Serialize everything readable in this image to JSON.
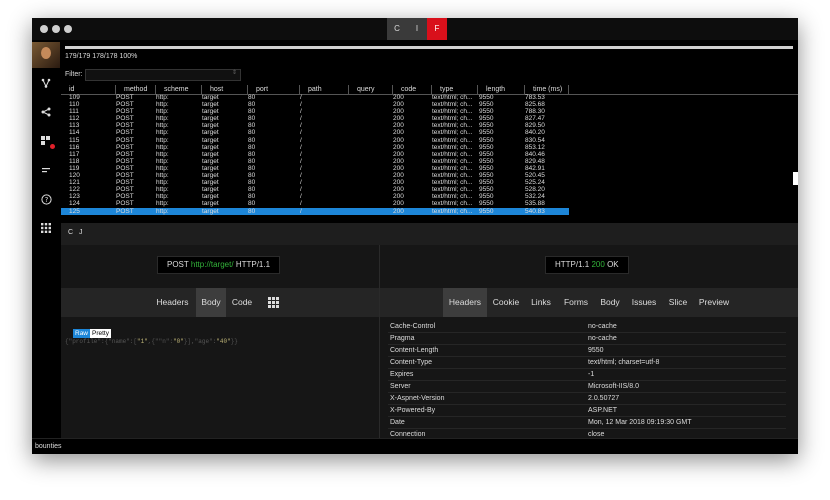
{
  "titlebar": {
    "modes": [
      "C",
      "I",
      "F"
    ],
    "active_mode": "F"
  },
  "progress": {
    "text": "179/179 178/178 100%",
    "fraction": 1.0
  },
  "filter": {
    "label": "Filter:",
    "value": ""
  },
  "table": {
    "columns": [
      "id",
      "method",
      "scheme",
      "host",
      "port",
      "path",
      "query",
      "code",
      "type",
      "length",
      "time (ms)"
    ],
    "rows": [
      [
        "109",
        "POST",
        "http:",
        "target",
        "80",
        "/",
        "",
        "200",
        "text/html; ch...",
        "9550",
        "783.53"
      ],
      [
        "110",
        "POST",
        "http:",
        "target",
        "80",
        "/",
        "",
        "200",
        "text/html; ch...",
        "9550",
        "825.68"
      ],
      [
        "111",
        "POST",
        "http:",
        "target",
        "80",
        "/",
        "",
        "200",
        "text/html; ch...",
        "9550",
        "788.30"
      ],
      [
        "112",
        "POST",
        "http:",
        "target",
        "80",
        "/",
        "",
        "200",
        "text/html; ch...",
        "9550",
        "827.47"
      ],
      [
        "113",
        "POST",
        "http:",
        "target",
        "80",
        "/",
        "",
        "200",
        "text/html; ch...",
        "9550",
        "829.50"
      ],
      [
        "114",
        "POST",
        "http:",
        "target",
        "80",
        "/",
        "",
        "200",
        "text/html; ch...",
        "9550",
        "840.20"
      ],
      [
        "115",
        "POST",
        "http:",
        "target",
        "80",
        "/",
        "",
        "200",
        "text/html; ch...",
        "9550",
        "830.54"
      ],
      [
        "116",
        "POST",
        "http:",
        "target",
        "80",
        "/",
        "",
        "200",
        "text/html; ch...",
        "9550",
        "853.12"
      ],
      [
        "117",
        "POST",
        "http:",
        "target",
        "80",
        "/",
        "",
        "200",
        "text/html; ch...",
        "9550",
        "840.46"
      ],
      [
        "118",
        "POST",
        "http:",
        "target",
        "80",
        "/",
        "",
        "200",
        "text/html; ch...",
        "9550",
        "829.48"
      ],
      [
        "119",
        "POST",
        "http:",
        "target",
        "80",
        "/",
        "",
        "200",
        "text/html; ch...",
        "9550",
        "842.91"
      ],
      [
        "120",
        "POST",
        "http:",
        "target",
        "80",
        "/",
        "",
        "200",
        "text/html; ch...",
        "9550",
        "520.45"
      ],
      [
        "121",
        "POST",
        "http:",
        "target",
        "80",
        "/",
        "",
        "200",
        "text/html; ch...",
        "9550",
        "525.24"
      ],
      [
        "122",
        "POST",
        "http:",
        "target",
        "80",
        "/",
        "",
        "200",
        "text/html; ch...",
        "9550",
        "528.20"
      ],
      [
        "123",
        "POST",
        "http:",
        "target",
        "80",
        "/",
        "",
        "200",
        "text/html; ch...",
        "9550",
        "532.24"
      ],
      [
        "124",
        "POST",
        "http:",
        "target",
        "80",
        "/",
        "",
        "200",
        "text/html; ch...",
        "9550",
        "535.88"
      ],
      [
        "125",
        "POST",
        "http:",
        "target",
        "80",
        "/",
        "",
        "200",
        "text/html; ch...",
        "9550",
        "540.83"
      ]
    ],
    "selected_row_index": 16
  },
  "actions": {
    "c": "C",
    "j": "J"
  },
  "request": {
    "summary": {
      "method": "POST",
      "url": "http://target/",
      "version": "HTTP/1.1"
    },
    "tabs": [
      "Headers",
      "Body",
      "Code"
    ],
    "active_tab": "Body",
    "view_modes": {
      "raw": "Raw",
      "pretty": "Pretty"
    },
    "body": {
      "p1": "{\"profile\":{\"name\":[",
      "v1": "\"1\"",
      "p2": ",{\"",
      "k": "\"n\"",
      "p3": ":",
      "v2": "\"0\"",
      "p4": "}],\"age\":",
      "v3": "\"40\"",
      "p5": "}}"
    }
  },
  "response": {
    "summary": {
      "version": "HTTP/1.1",
      "status_code": "200",
      "status_text": "OK"
    },
    "tabs": [
      "Headers",
      "Cookie",
      "Links",
      "Forms",
      "Body",
      "Issues",
      "Slice",
      "Preview"
    ],
    "active_tab": "Headers",
    "headers": [
      {
        "name": "Cache-Control",
        "value": "no-cache"
      },
      {
        "name": "Pragma",
        "value": "no-cache"
      },
      {
        "name": "Content-Length",
        "value": "9550"
      },
      {
        "name": "Content-Type",
        "value": "text/html; charset=utf-8"
      },
      {
        "name": "Expires",
        "value": "-1"
      },
      {
        "name": "Server",
        "value": "Microsoft-IIS/8.0"
      },
      {
        "name": "X-Aspnet-Version",
        "value": "2.0.50727"
      },
      {
        "name": "X-Powered-By",
        "value": "ASP.NET"
      },
      {
        "name": "Date",
        "value": "Mon, 12 Mar 2018 09:19:30 GMT"
      },
      {
        "name": "Connection",
        "value": "close"
      }
    ]
  },
  "statusbar": {
    "text": "bounties"
  },
  "colors": {
    "accent": "#1d86d8",
    "active_mode": "#d9101b",
    "status_ok": "#33b33a"
  }
}
